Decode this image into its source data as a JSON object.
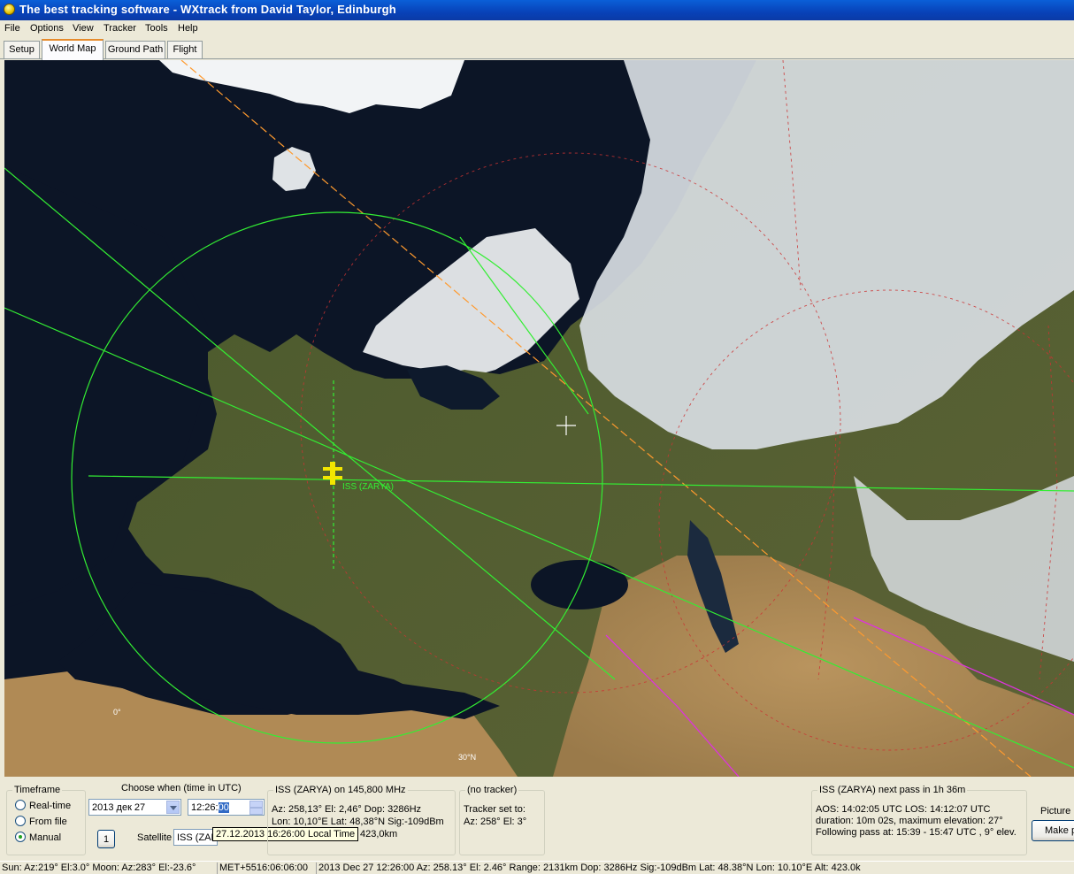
{
  "window": {
    "title": "The best tracking software - WXtrack from David Taylor, Edinburgh"
  },
  "menu": [
    "File",
    "Options",
    "View",
    "Tracker",
    "Tools",
    "Help"
  ],
  "tabs": [
    {
      "label": "Setup",
      "active": false
    },
    {
      "label": "World Map",
      "active": true
    },
    {
      "label": "Ground Path",
      "active": false
    },
    {
      "label": "Flight",
      "active": false
    }
  ],
  "map": {
    "satellite_label": "ISS (ZARYA)",
    "lon_label": "0°",
    "lat_label": "30°N",
    "colors": {
      "footprint": "#33ee33",
      "ground_track": "#ff9a2e",
      "pass_track": "#dd33dd",
      "sun_lines": "#cc3333",
      "satellite": "#f2e600"
    }
  },
  "timeframe": {
    "title": "Timeframe",
    "options": [
      "Real-time",
      "From file",
      "Manual"
    ],
    "selected": "Manual"
  },
  "choose_when": {
    "title": "Choose when (time in UTC)",
    "date": "2013 дек 27",
    "time_prefix": "12:26:",
    "time_selected": "00",
    "step_button": "1",
    "satellite_label": "Satellite",
    "satellite_value": "ISS (ZAR",
    "tooltip": "27.12.2013 16:26:00  Local Time"
  },
  "sat_info": {
    "title": "ISS (ZARYA) on 145,800 MHz",
    "line1": "Az: 258,13°  El: 2,46°  Dop: 3286Hz",
    "line2": "Lon: 10,10°E  Lat: 48,38°N  Sig:-109dBm",
    "line3": "423,0km"
  },
  "tracker": {
    "title": "(no tracker)",
    "line1": "Tracker set to:",
    "line2": "Az: 258°  El: 3°"
  },
  "next_pass": {
    "title": "ISS (ZARYA) next pass in 1h 36m",
    "line1": "AOS: 14:02:05 UTC  LOS: 14:12:07 UTC",
    "line2": "duration: 10m 02s,  maximum elevation: 27°",
    "line3": "Following pass at: 15:39 - 15:47 UTC , 9° elev."
  },
  "picture": {
    "label": "Picture l",
    "button": "Make p"
  },
  "status": {
    "sunmoon": "Sun: Az:219° El:3.0°  Moon: Az:283° El:-23.6°",
    "met": "MET+5516:06:06:00",
    "detail": "2013 Dec 27  12:26:00  Az: 258.13°  El: 2.46°  Range: 2131km  Dop: 3286Hz  Sig:-109dBm  Lat: 48.38°N  Lon: 10.10°E  Alt: 423.0k"
  }
}
